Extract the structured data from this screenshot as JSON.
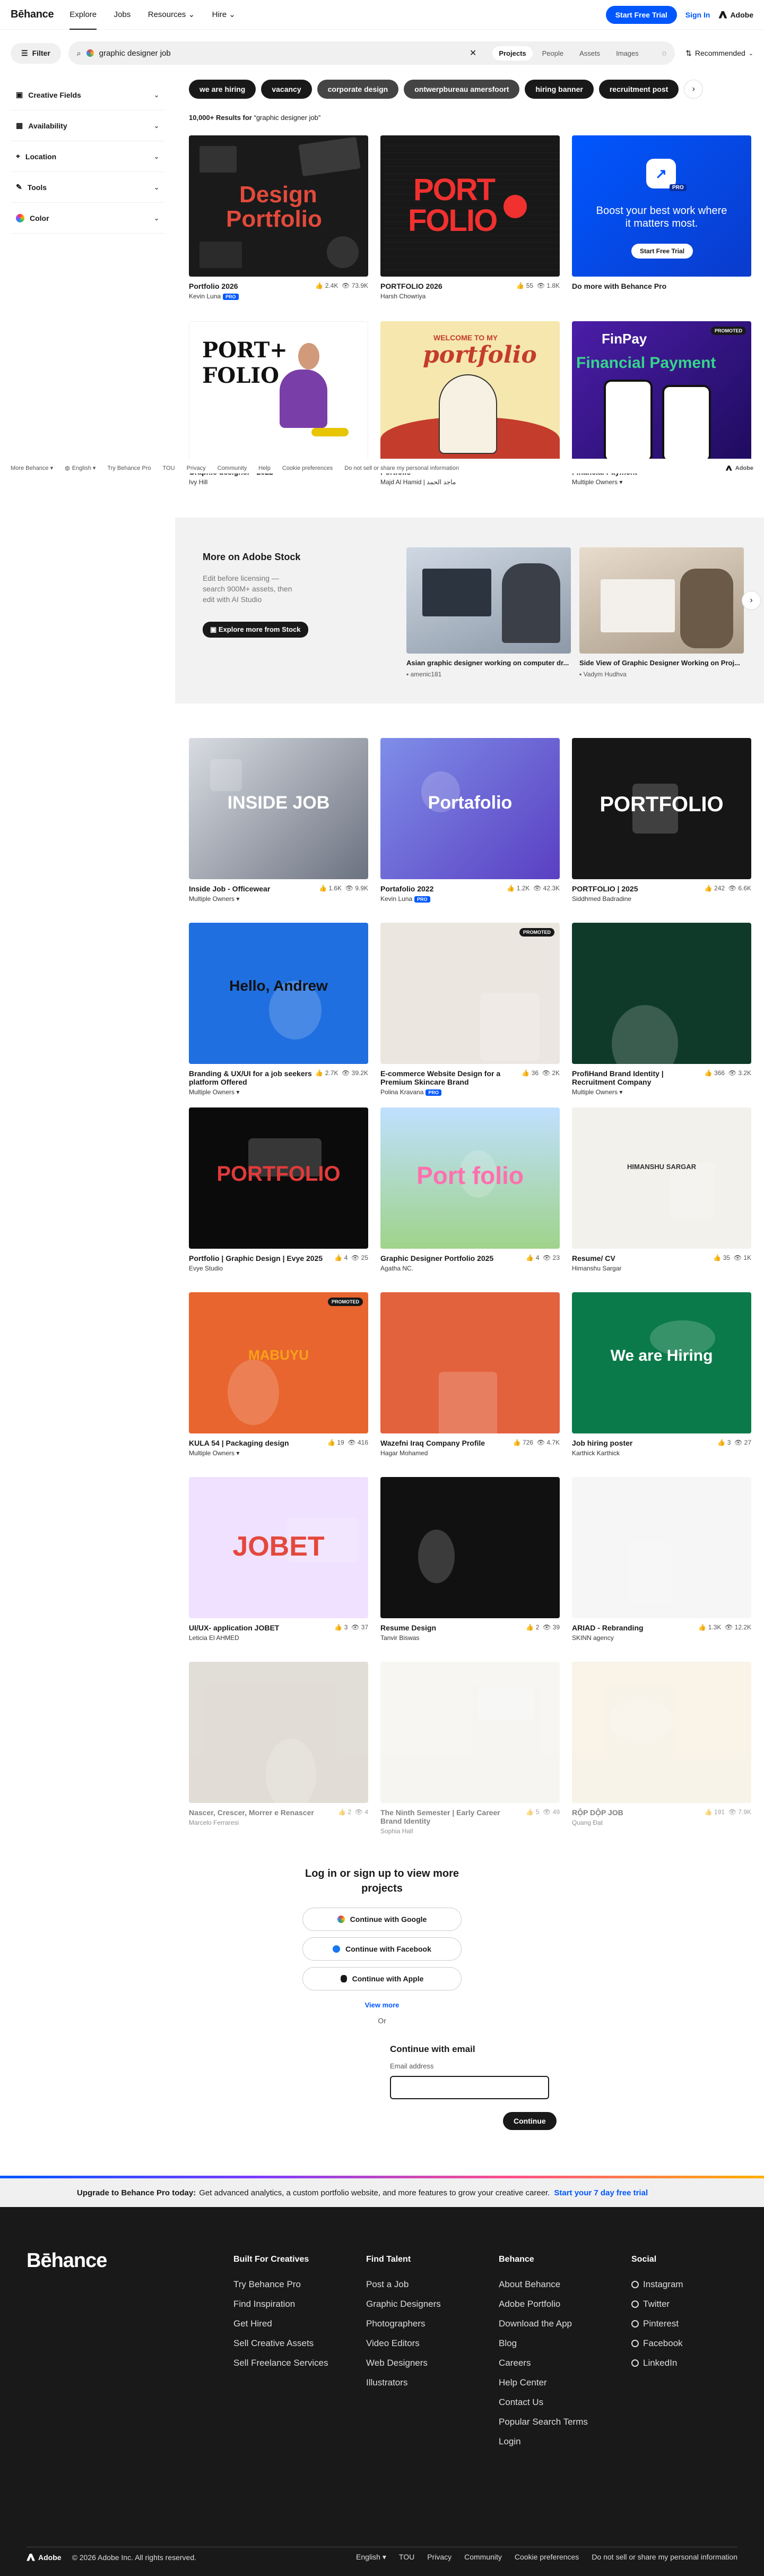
{
  "header": {
    "logo": "Bēhance",
    "nav": [
      "Explore",
      "Jobs",
      "Resources ⌄",
      "Hire ⌄"
    ],
    "trial_button": "Start Free Trial",
    "signin": "Sign In",
    "adobe": "Adobe"
  },
  "search": {
    "filter_label": "Filter",
    "query": "graphic designer job",
    "scopes": [
      "Projects",
      "People",
      "Assets",
      "Images"
    ],
    "sort": "Recommended"
  },
  "sidebar": {
    "items": [
      "Creative Fields",
      "Availability",
      "Location",
      "Tools",
      "Color"
    ]
  },
  "chips": [
    "we are hiring",
    "vacancy",
    "corporate design",
    "ontwerpbureau amersfoort",
    "hiring banner",
    "recruitment post"
  ],
  "results": {
    "count": "10,000+ Results for",
    "query": "“graphic designer job”"
  },
  "row1": [
    {
      "title": "Portfolio 2026",
      "owner": "Kevin Luna",
      "pro": "PRO",
      "likes": "2.4K",
      "views": "73.9K",
      "art_a": "Design",
      "art_b": "Portfolio"
    },
    {
      "title": "PORTFOLIO 2026",
      "owner": "Harsh Chowriya",
      "likes": "55",
      "views": "1.8K",
      "art_a": "PORT",
      "art_b": "FOLIO"
    },
    {
      "title": "Do more with Behance Pro",
      "owner": "",
      "pro_badge": "PRO",
      "art_a": "Boost your best work where it matters most.",
      "art_b": "Start Free Trial"
    }
  ],
  "row2": [
    {
      "title": "Graphic designer - 2022",
      "owner": "Ivy Hill",
      "art_a": "PORT+",
      "art_b": "FOLIO"
    },
    {
      "title": "Portfolio",
      "owner": "Majd Al Hamid | ماجد الحمد",
      "art_a": "WELCOME TO MY",
      "art_b": "portfolio"
    },
    {
      "title": "Financial Payment",
      "owner": "Multiple Owners ▾",
      "badge": "PROMOTED",
      "art_a": "FinPay",
      "art_b": "Financial Payment"
    }
  ],
  "mini_footer": [
    "More Behance ▾",
    "English ▾",
    "Try Behance Pro",
    "TOU",
    "Privacy",
    "Community",
    "Help",
    "Cookie preferences",
    "Do not sell or share my personal information"
  ],
  "stock": {
    "title": "More on Adobe Stock",
    "desc": "Edit before licensing — search 900M+ assets, then edit with AI Studio",
    "button": "Explore more from Stock",
    "items": [
      {
        "caption": "Asian graphic designer working on computer dr...",
        "author": "amenic181"
      },
      {
        "caption": "Side View of Graphic Designer Working on Proj...",
        "author": "Vadym Hudhva"
      }
    ]
  },
  "grid": [
    {
      "title": "Inside Job - Officewear",
      "owner": "Multiple Owners ▾",
      "likes": "1.6K",
      "views": "9.9K",
      "art": "INSIDE JOB"
    },
    {
      "title": "Portafolio 2022",
      "owner": "Kevin Luna",
      "pro": "PRO",
      "likes": "1.2K",
      "views": "42.3K",
      "art": "Portafolio"
    },
    {
      "title": "PORTFOLIO | 2025",
      "owner": "Siddhmed Badradine",
      "likes": "242",
      "views": "6.6K",
      "art": "PORTFOLIO"
    },
    {
      "title": "Branding & UX/UI for a job seekers platform Offered",
      "owner": "Multiple Owners ▾",
      "likes": "2.7K",
      "views": "39.2K",
      "art": "Hello, Andrew"
    },
    {
      "title": "E-commerce Website Design for a Premium Skincare Brand",
      "owner": "Polina Kravana",
      "pro": "PRO",
      "likes": "36",
      "views": "2K",
      "badge": "PROMOTED",
      "art": ""
    },
    {
      "title": "ProfiHand Brand Identity | Recruitment Company",
      "owner": "Multiple Owners ▾",
      "likes": "366",
      "views": "3.2K",
      "art": ""
    },
    {
      "title": "Portfolio | Graphic Design | Evye 2025",
      "owner": "Evye Studio",
      "likes": "4",
      "views": "25",
      "art": "PORTFOLIO"
    },
    {
      "title": "Graphic Designer Portfolio 2025",
      "owner": "Agatha NC.",
      "likes": "4",
      "views": "23",
      "art": "Port folio"
    },
    {
      "title": "Resume/ CV",
      "owner": "Himanshu Sargar",
      "likes": "35",
      "views": "1K",
      "art": "HIMANSHU SARGAR"
    },
    {
      "title": "KULA 54 | Packaging design",
      "owner": "Multiple Owners ▾",
      "likes": "19",
      "views": "416",
      "badge": "PROMOTED",
      "art": "MABUYU"
    },
    {
      "title": "Wazefni Iraq Company Profile",
      "owner": "Hagar Mohamed",
      "likes": "726",
      "views": "4.7K",
      "art": ""
    },
    {
      "title": "Job hiring poster",
      "owner": "Karthick Karthick",
      "likes": "3",
      "views": "27",
      "art": "We are Hiring"
    },
    {
      "title": "UI/UX- application JOBET",
      "owner": "Leticia El AHMED",
      "likes": "3",
      "views": "37",
      "art": "JOBET"
    },
    {
      "title": "Resume Design",
      "owner": "Tanvir Biswas",
      "likes": "2",
      "views": "39",
      "art": ""
    },
    {
      "title": "ARIAD - Rebranding",
      "owner": "SKINN agency",
      "likes": "1.3K",
      "views": "12.2K",
      "art": ""
    },
    {
      "title": "Nascer, Crescer, Morrer e Renascer",
      "owner": "Marcelo Ferraresi",
      "likes": "2",
      "views": "4",
      "art": ""
    },
    {
      "title": "The Ninth Semester | Early Career Brand Identity",
      "owner": "Sophia Hall",
      "likes": "5",
      "views": "49",
      "art": ""
    },
    {
      "title": "RỘP DỘP JOB",
      "owner": "Quang Đạt",
      "likes": "191",
      "views": "7.9K",
      "art": ""
    }
  ],
  "login": {
    "title": "Log in or sign up to view more projects",
    "google": "Continue with Google",
    "facebook": "Continue with Facebook",
    "apple": "Continue with Apple",
    "view_more": "View more",
    "or": "Or",
    "email_title": "Continue with email",
    "email_label": "Email address",
    "continue": "Continue"
  },
  "promo": {
    "bold": "Upgrade to Behance Pro today:",
    "text": "Get advanced analytics, a custom portfolio website, and more features to grow your creative career.",
    "link": "Start your 7 day free trial"
  },
  "footer": {
    "logo": "Bēhance",
    "cols": [
      {
        "title": "Built For Creatives",
        "items": [
          "Try Behance Pro",
          "Find Inspiration",
          "Get Hired",
          "Sell Creative Assets",
          "Sell Freelance Services"
        ]
      },
      {
        "title": "Find Talent",
        "items": [
          "Post a Job",
          "Graphic Designers",
          "Photographers",
          "Video Editors",
          "Web Designers",
          "Illustrators"
        ]
      },
      {
        "title": "Behance",
        "items": [
          "About Behance",
          "Adobe Portfolio",
          "Download the App",
          "Blog",
          "Careers",
          "Help Center",
          "Contact Us",
          "Popular Search Terms",
          "Login"
        ]
      },
      {
        "title": "Social",
        "items": [
          "Instagram",
          "Twitter",
          "Pinterest",
          "Facebook",
          "LinkedIn"
        ]
      }
    ],
    "adobe": "Adobe",
    "copyright": "© 2026 Adobe Inc. All rights reserved.",
    "links": [
      "English ▾",
      "TOU",
      "Privacy",
      "Community",
      "Cookie preferences",
      "Do not sell or share my personal information"
    ]
  },
  "colors": {
    "accent": "#0057ff",
    "dark": "#191919",
    "footer_bg": "#191919"
  }
}
